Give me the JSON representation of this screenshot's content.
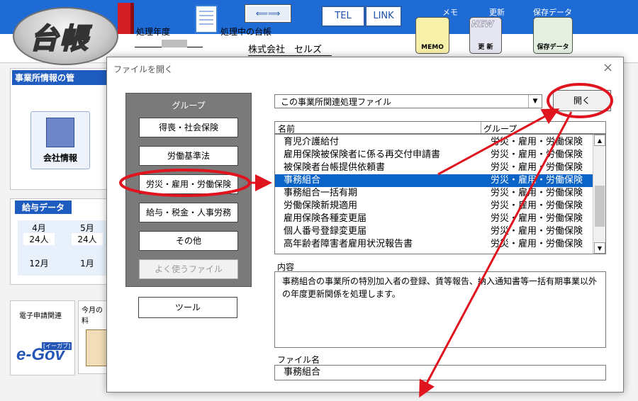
{
  "app": {
    "logo": "台帳",
    "fiscal_year_label": "処理年度",
    "current_ledger_label": "処理中の台帳",
    "company_name": "株式会社　セルズ",
    "tel_button": "TEL",
    "link_button": "LINK",
    "memo_label": "メモ",
    "memo_icon": "MEMO",
    "update_label": "更新",
    "update_icon": "更 新",
    "update_badge": "NEW",
    "save_label": "保存データ",
    "save_icon": "保存データ",
    "office_info_header": "事業所情報の管",
    "company_info_button": "会社情報",
    "salary_tab": "給与データ",
    "salary_months": [
      "4月",
      "5月"
    ],
    "salary_counts": [
      "24人",
      "24人"
    ],
    "salary_months2": [
      "12月",
      "1月"
    ],
    "egov_title": "電子申請関連",
    "egov_logo": "e-Gov",
    "egov_sub": "[イーガブ]",
    "thismonth": "今月の料"
  },
  "dialog": {
    "title": "ファイルを開く",
    "close": "×",
    "group_header": "グループ",
    "group_buttons": [
      "得喪・社会保険",
      "労働基準法",
      "労災・雇用・労働保険",
      "給与・税金・人事労務",
      "その他",
      "よく使うファイル"
    ],
    "tool_button": "ツール",
    "combo_value": "この事業所関連処理ファイル",
    "open_button": "開く",
    "col_name": "名前",
    "col_group": "グループ",
    "rows": [
      {
        "name": "育児介護給付",
        "group": "労災・雇用・労働保険"
      },
      {
        "name": "雇用保険被保険者に係る再交付申請書",
        "group": "労災・雇用・労働保険"
      },
      {
        "name": "被保険者台帳提供依頼書",
        "group": "労災・雇用・労働保険"
      },
      {
        "name": "事務組合",
        "group": "労災・雇用・労働保険"
      },
      {
        "name": "事務組合一括有期",
        "group": "労災・雇用・労働保険"
      },
      {
        "name": "労働保険新規適用",
        "group": "労災・雇用・労働保険"
      },
      {
        "name": "雇用保険各種変更届",
        "group": "労災・雇用・労働保険"
      },
      {
        "name": "個人番号登録変更届",
        "group": "労災・雇用・労働保険"
      },
      {
        "name": "高年齢者障害者雇用状況報告書",
        "group": "労災・雇用・労働保険"
      }
    ],
    "selected_index": 3,
    "desc_label": "内容",
    "desc_text": "事務組合の事業所の特別加入者の登録、賃等報告、納入通知書等一括有期事業以外の年度更新関係を処理します。",
    "filename_label": "ファイル名",
    "filename_value": "事務組合"
  },
  "colors": {
    "title_blue": "#1f6bd6",
    "selection": "#0a64c8",
    "annotation_red": "#e0141e"
  }
}
